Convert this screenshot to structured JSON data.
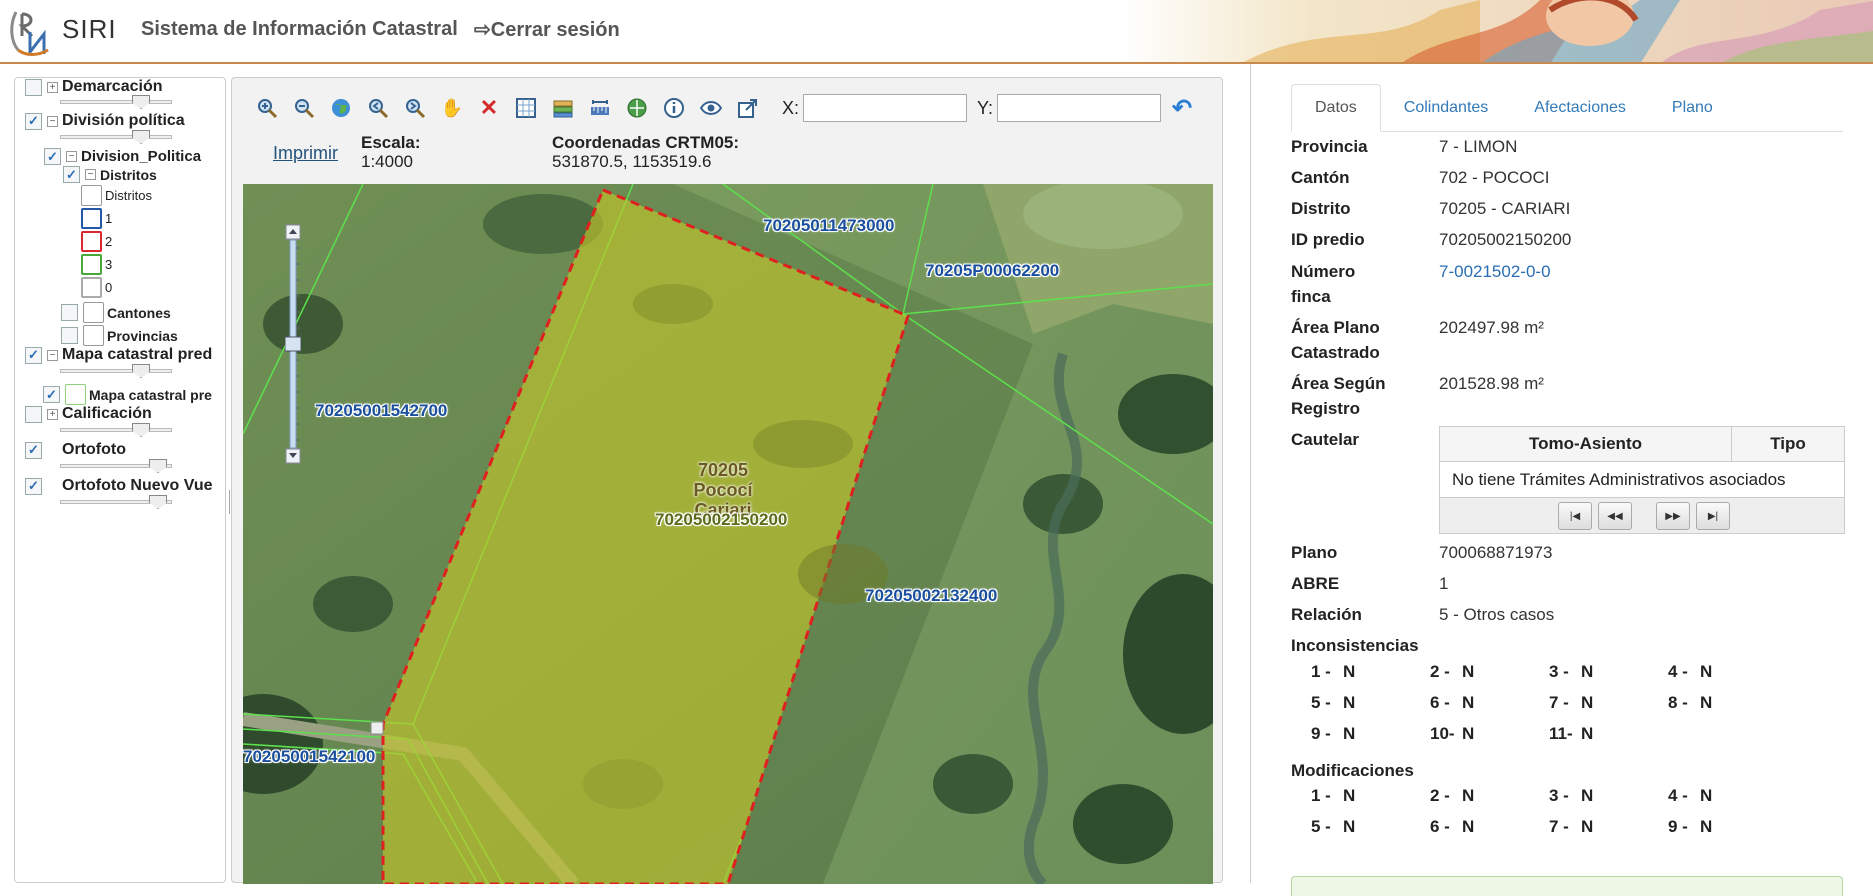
{
  "header": {
    "logo_text": "SIRI",
    "app_title": "Sistema de Información Catastral",
    "logout_label": "Cerrar sesión"
  },
  "layers": {
    "demarcacion": "Demarcación",
    "division_politica": "División política",
    "division_politica_sub": "Division_Politica",
    "distritos": "Distritos",
    "legend_distritos": "Distritos",
    "legend_items": [
      "1",
      "2",
      "3",
      "0"
    ],
    "legend_colors": [
      "#2457a6",
      "#d9282f",
      "#4aa83a",
      "#aaaaaa"
    ],
    "cantones": "Cantones",
    "provincias": "Provincias",
    "mapa_catastral": "Mapa catastral pred",
    "mapa_catastral_sub": "Mapa catastral pre",
    "calificacion": "Calificación",
    "ortofoto": "Ortofoto",
    "ortofoto_nuevo": "Ortofoto Nuevo Vue",
    "opacity": {
      "demarcacion": 0.77,
      "division_politica": 0.77,
      "mapa_catastral": 0.77,
      "calificacion": 0.77,
      "ortofoto": 0.95,
      "ortofoto_nuevo": 0.95
    }
  },
  "map_panel": {
    "toolbar_icons": [
      "zoom-in-icon",
      "zoom-out-icon",
      "globe-icon",
      "zoom-previous-icon",
      "zoom-next-icon",
      "pan-hand-icon",
      "clear-icon",
      "select-box-icon",
      "layers-icon",
      "measure-icon",
      "identify-globe-icon",
      "info-icon",
      "view-eye-icon",
      "external-link-icon"
    ],
    "x_label": "X:",
    "y_label": "Y:",
    "x_value": "",
    "y_value": "",
    "print_label": "Imprimir",
    "scale_label": "Escala:",
    "scale_value": "1:4000",
    "coords_label": "Coordenadas CRTM05:",
    "coords_value": "531870.5, 1153519.6"
  },
  "map": {
    "zoom_level": 0.5,
    "parcel_labels": [
      "70205011473000",
      "70205P00062200",
      "70205001542700",
      "70205002132400",
      "70205001542100"
    ],
    "center_labels": [
      "70205",
      "Pococí",
      "Cariari",
      "70205002150200"
    ]
  },
  "details": {
    "tabs": [
      "Datos",
      "Colindantes",
      "Afectaciones",
      "Plano"
    ],
    "active_tab": "Datos",
    "fields": {
      "provincia_label": "Provincia",
      "provincia": "7 - LIMON",
      "canton_label": "Cantón",
      "canton": "702 - POCOCI",
      "distrito_label": "Distrito",
      "distrito": "70205 - CARIARI",
      "id_predio_label": "ID predio",
      "id_predio": "70205002150200",
      "numero_finca_label_1": "Número",
      "numero_finca_label_2": "finca",
      "numero_finca": "7-0021502-0-0",
      "area_plano_label_1": "Área Plano",
      "area_plano_label_2": "Catastrado",
      "area_plano": "202497.98 m²",
      "area_registro_label_1": "Área Según",
      "area_registro_label_2": "Registro",
      "area_registro": "201528.98 m²",
      "cautelar_label": "Cautelar",
      "plano_label": "Plano",
      "plano": "700068871973",
      "abre_label": "ABRE",
      "abre": "1",
      "relacion_label": "Relación",
      "relacion": "5 - Otros casos",
      "inconsistencias_label": "Inconsistencias",
      "modificaciones_label": "Modificaciones"
    },
    "cautelar_grid": {
      "columns": [
        "Tomo-Asiento",
        "Tipo"
      ],
      "empty_message": "No tiene Trámites Administrativos asociados"
    },
    "inconsistencias": [
      {
        "n": "1 -",
        "v": "N"
      },
      {
        "n": "2 -",
        "v": "N"
      },
      {
        "n": "3 -",
        "v": "N"
      },
      {
        "n": "4 -",
        "v": "N"
      },
      {
        "n": "5 -",
        "v": "N"
      },
      {
        "n": "6 -",
        "v": "N"
      },
      {
        "n": "7 -",
        "v": "N"
      },
      {
        "n": "8 -",
        "v": "N"
      },
      {
        "n": "9 -",
        "v": "N"
      },
      {
        "n": "10-",
        "v": "N"
      },
      {
        "n": "11-",
        "v": "N"
      }
    ],
    "modificaciones": [
      {
        "n": "1 -",
        "v": "N"
      },
      {
        "n": "2 -",
        "v": "N"
      },
      {
        "n": "3 -",
        "v": "N"
      },
      {
        "n": "4 -",
        "v": "N"
      },
      {
        "n": "5 -",
        "v": "N"
      },
      {
        "n": "6 -",
        "v": "N"
      },
      {
        "n": "7 -",
        "v": "N"
      },
      {
        "n": "9 -",
        "v": "N"
      }
    ]
  }
}
